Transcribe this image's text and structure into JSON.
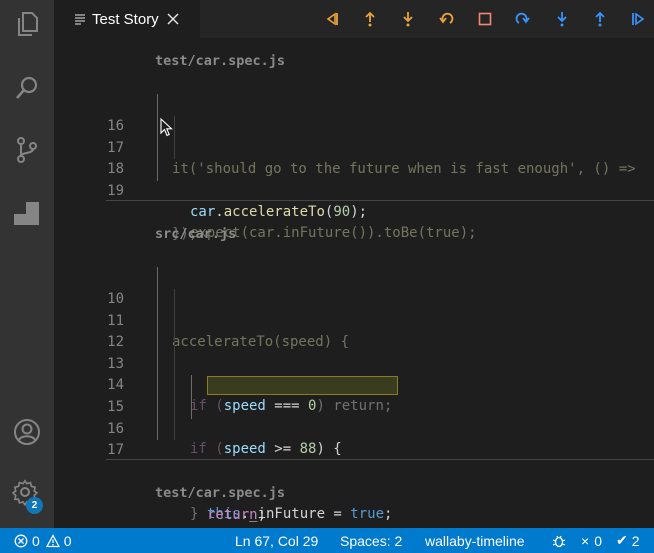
{
  "tab": {
    "title": "Test Story"
  },
  "activity": {
    "settings_badge": "2"
  },
  "editor": {
    "section1": {
      "file": "test/car.spec.js",
      "lines": [
        "16",
        "17",
        "18",
        "19"
      ],
      "code": {
        "l16": "it('should go to the future when is fast enough', () =>",
        "l17a": "car",
        "l17b": ".",
        "l17c": "accelerateTo",
        "l17d": "(",
        "l17e": "90",
        "l17f": ");",
        "l18": "expect(car.inFuture()).toBe(true);",
        "l19": "});"
      }
    },
    "section2": {
      "file": "src/car.js",
      "lines": [
        "10",
        "11",
        "12",
        "13",
        "14",
        "15",
        "16",
        "17"
      ],
      "code": {
        "l10": "accelerateTo(speed) {",
        "l12a": "if (",
        "l12b": "speed",
        "l12c": " === ",
        "l12d": "0",
        "l12e": ") return;",
        "l14a": "if (",
        "l14b": "speed",
        "l14c": " >= ",
        "l14d": "88",
        "l14e": ") {",
        "l15a": "this",
        "l15b": "._inFuture = ",
        "l15c": "true",
        "l15d": ";",
        "l16a": "return",
        "l16b": ";",
        "l17": "}"
      }
    },
    "section3": {
      "file": "test/car.spec.js"
    }
  },
  "status": {
    "errors": "0",
    "warnings": "0",
    "position": "Ln 67, Col 29",
    "spaces": "Spaces: 2",
    "mode": "wallaby-timeline",
    "fail_count": "0",
    "pass_count": "2"
  },
  "colors": {
    "accent": "#007acc",
    "debug_orange": "#e8a33d",
    "debug_blue": "#3794ff",
    "stop_red": "#f48771"
  }
}
